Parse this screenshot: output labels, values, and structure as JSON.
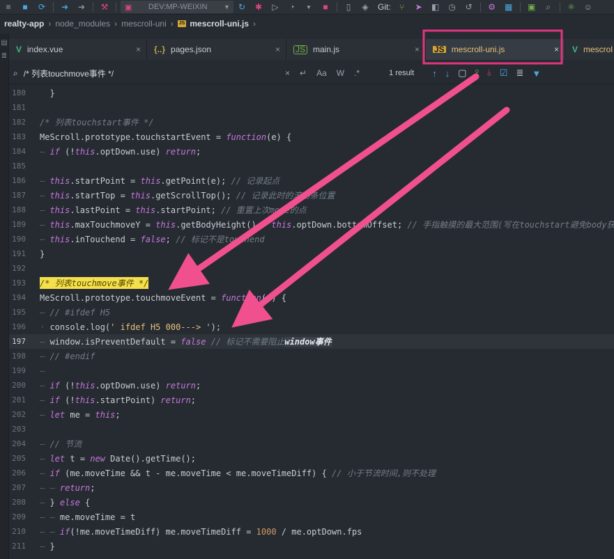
{
  "toolbar": {
    "device": "DEV:MP-WEIXIN",
    "git_label": "Git:"
  },
  "breadcrumb": {
    "segments": [
      "realty-app",
      "node_modules",
      "mescroll-uni"
    ],
    "current": "mescroll-uni.js"
  },
  "tabs": [
    {
      "label": "index.vue",
      "icon": "vue-icon",
      "close": "×"
    },
    {
      "label": "pages.json",
      "icon": "json-icon",
      "close": "×"
    },
    {
      "label": "main.js",
      "icon": "node-icon",
      "close": "×"
    },
    {
      "label": "mescroll-uni.js",
      "icon": "js-icon",
      "close": "×"
    },
    {
      "label": "mescrol",
      "icon": "vue-icon",
      "close": ""
    }
  ],
  "find": {
    "query": "/* 列表touchmove事件 */",
    "case_label": "Aa",
    "word_label": "W",
    "regex_label": ".*",
    "result": "1 result"
  },
  "colors": {
    "highlight_box": "#e3357f",
    "arrow": "#f0508e",
    "search_match": "#f4e04d"
  },
  "code": {
    "lines": [
      {
        "n": "180",
        "t": "}"
      },
      {
        "n": "181",
        "t": ""
      },
      {
        "n": "182",
        "t": "/* 列表touchstart事件 */"
      },
      {
        "n": "183",
        "t": "MeScroll.prototype.touchstartEvent = function(e) {"
      },
      {
        "n": "184",
        "t": "if (!this.optDown.use) return;"
      },
      {
        "n": "185",
        "t": ""
      },
      {
        "n": "186",
        "t": "this.startPoint = this.getPoint(e); // 记录起点"
      },
      {
        "n": "187",
        "t": "this.startTop = this.getScrollTop(); // 记录此时的滚动条位置"
      },
      {
        "n": "188",
        "t": "this.lastPoint = this.startPoint; // 重置上次move的点"
      },
      {
        "n": "189",
        "t": "this.maxTouchmoveY = this.getBodyHeight() - this.optDown.bottomOffset; // 手指触摸的最大范围(写在touchstart避免body获"
      },
      {
        "n": "190",
        "t": "this.inTouchend = false; // 标记不是touchend"
      },
      {
        "n": "191",
        "t": "}"
      },
      {
        "n": "192",
        "t": ""
      },
      {
        "n": "193",
        "t": "/* 列表touchmove事件 */"
      },
      {
        "n": "194",
        "t": "MeScroll.prototype.touchmoveEvent = function(e) {"
      },
      {
        "n": "195",
        "t": "// #ifdef H5"
      },
      {
        "n": "196",
        "t": "console.log(' ifdef H5 000---> ');"
      },
      {
        "n": "197",
        "t": "window.isPreventDefault = false // 标记不需要阻止window事件"
      },
      {
        "n": "198",
        "t": "// #endif"
      },
      {
        "n": "199",
        "t": ""
      },
      {
        "n": "200",
        "t": "if (!this.optDown.use) return;"
      },
      {
        "n": "201",
        "t": "if (!this.startPoint) return;"
      },
      {
        "n": "202",
        "t": "let me = this;"
      },
      {
        "n": "203",
        "t": ""
      },
      {
        "n": "204",
        "t": "// 节流"
      },
      {
        "n": "205",
        "t": "let t = new Date().getTime();"
      },
      {
        "n": "206",
        "t": "if (me.moveTime && t - me.moveTime < me.moveTimeDiff) { // 小于节流时间,则不处理"
      },
      {
        "n": "207",
        "t": "return;"
      },
      {
        "n": "208",
        "t": "} else {"
      },
      {
        "n": "209",
        "t": "me.moveTime = t"
      },
      {
        "n": "210",
        "t": "if(!me.moveTimeDiff) me.moveTimeDiff = 1000 / me.optDown.fps"
      },
      {
        "n": "211",
        "t": "}"
      }
    ]
  }
}
